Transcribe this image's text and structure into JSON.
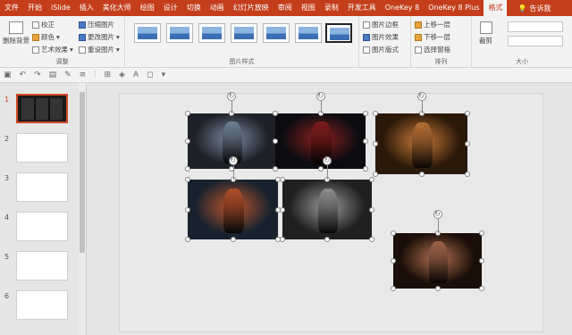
{
  "menu": {
    "items": [
      "文件",
      "开始",
      "iSlide",
      "插入",
      "美化大师",
      "绘图",
      "设计",
      "切换",
      "动画",
      "幻灯片放映",
      "审阅",
      "视图",
      "录制",
      "开发工具",
      "OneKey 8",
      "OneKey 8 Plus",
      "格式"
    ],
    "active": "格式",
    "tell_me": "告诉我"
  },
  "ribbon": {
    "adjust": {
      "remove_bg": "删除背景",
      "correct": "校正",
      "color": "颜色",
      "artistic": "艺术效果",
      "compress": "压缩图片",
      "change": "更改图片",
      "reset": "重设图片",
      "label": "调整"
    },
    "styles": {
      "border": "图片边框",
      "effects": "图片效果",
      "layout": "图片版式",
      "label": "图片样式"
    },
    "arrange": {
      "bring_forward": "上移一层",
      "send_backward": "下移一层",
      "selection_pane": "选择窗格",
      "label": "排列"
    },
    "size": {
      "crop": "裁剪",
      "label": "大小"
    }
  },
  "slides": {
    "numbers": [
      "1",
      "2",
      "3",
      "4",
      "5",
      "6"
    ],
    "selected": "1"
  },
  "photos": [
    {
      "name": "woman-feather-photo",
      "bg": "#1e2128",
      "accent": "#7a8aa0"
    },
    {
      "name": "woman-red-boots-photo",
      "bg": "#0c0c10",
      "accent": "#8c2020"
    },
    {
      "name": "woman-golden-light-photo",
      "bg": "#2a1808",
      "accent": "#c97a3a"
    },
    {
      "name": "woman-blue-chair-photo",
      "bg": "#17222e",
      "accent": "#c2562c"
    },
    {
      "name": "woman-black-white-photo",
      "bg": "#202020",
      "accent": "#9a9a9a"
    },
    {
      "name": "woman-portrait-photo",
      "bg": "#1a0e08",
      "accent": "#b07050"
    }
  ],
  "colors": {
    "brand": "#c43e1c",
    "ribbon_bg": "#f3f3f3",
    "selection": "#d24726"
  }
}
